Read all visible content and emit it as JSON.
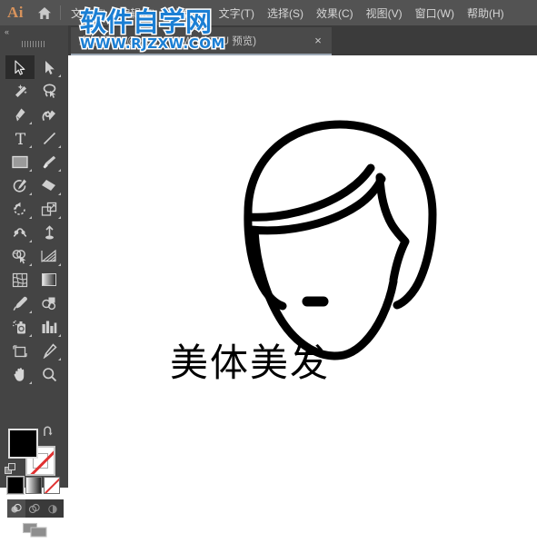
{
  "app": {
    "logo_text": "Ai",
    "home_icon": "home-icon"
  },
  "menu": {
    "items": [
      {
        "label": "文件(F)"
      },
      {
        "label": "编辑(E)"
      },
      {
        "label": "对象(O)"
      },
      {
        "label": "文字(T)"
      },
      {
        "label": "选择(S)"
      },
      {
        "label": "效果(C)"
      },
      {
        "label": "视图(V)"
      },
      {
        "label": "窗口(W)"
      },
      {
        "label": "帮助(H)"
      }
    ]
  },
  "tabs": {
    "active": {
      "title": "未标题-1* @ 100% (CMYK/GPU 预览)",
      "close_label": "×"
    }
  },
  "left_panel": {
    "collapse_label": "«"
  },
  "toolbar": {
    "tools": [
      {
        "name": "selection-tool",
        "active": true,
        "corner": false
      },
      {
        "name": "direct-selection-tool",
        "active": false,
        "corner": true
      },
      {
        "name": "magic-wand-tool",
        "active": false,
        "corner": false
      },
      {
        "name": "lasso-tool",
        "active": false,
        "corner": false
      },
      {
        "name": "pen-tool",
        "active": false,
        "corner": true
      },
      {
        "name": "curvature-tool",
        "active": false,
        "corner": false
      },
      {
        "name": "type-tool",
        "active": false,
        "corner": true
      },
      {
        "name": "line-segment-tool",
        "active": false,
        "corner": true
      },
      {
        "name": "rectangle-tool",
        "active": false,
        "corner": true
      },
      {
        "name": "paintbrush-tool",
        "active": false,
        "corner": true
      },
      {
        "name": "shaper-tool",
        "active": false,
        "corner": true
      },
      {
        "name": "eraser-tool",
        "active": false,
        "corner": true
      },
      {
        "name": "rotate-tool",
        "active": false,
        "corner": true
      },
      {
        "name": "scale-tool",
        "active": false,
        "corner": true
      },
      {
        "name": "width-tool",
        "active": false,
        "corner": true
      },
      {
        "name": "free-transform-tool",
        "active": false,
        "corner": false
      },
      {
        "name": "shape-builder-tool",
        "active": false,
        "corner": true
      },
      {
        "name": "perspective-grid-tool",
        "active": false,
        "corner": true
      },
      {
        "name": "mesh-tool",
        "active": false,
        "corner": false
      },
      {
        "name": "gradient-tool",
        "active": false,
        "corner": false
      },
      {
        "name": "eyedropper-tool",
        "active": false,
        "corner": true
      },
      {
        "name": "blend-tool",
        "active": false,
        "corner": false
      },
      {
        "name": "symbol-sprayer-tool",
        "active": false,
        "corner": true
      },
      {
        "name": "column-graph-tool",
        "active": false,
        "corner": true
      },
      {
        "name": "artboard-tool",
        "active": false,
        "corner": false
      },
      {
        "name": "slice-tool",
        "active": false,
        "corner": true
      },
      {
        "name": "hand-tool",
        "active": false,
        "corner": true
      },
      {
        "name": "zoom-tool",
        "active": false,
        "corner": false
      }
    ],
    "fill_color": "#000000",
    "stroke_color": "#ffffff",
    "swap_label": "⤴",
    "color_modes": [
      {
        "name": "color-mode-solid",
        "selected": true
      },
      {
        "name": "color-mode-gradient",
        "selected": false
      },
      {
        "name": "color-mode-none",
        "selected": false
      }
    ],
    "draw_modes": [
      {
        "name": "draw-normal-mode",
        "selected": true
      },
      {
        "name": "draw-behind-mode",
        "selected": false
      },
      {
        "name": "draw-inside-mode",
        "selected": false
      }
    ],
    "screen_mode": "change-screen-mode"
  },
  "artwork": {
    "label": "美体美发",
    "stroke_color": "#000000",
    "icon_name": "woman-face-hair-logo"
  },
  "watermark": {
    "main": "软件自学网",
    "sub": "WWW.RJZXW.COM",
    "color": "#1b7fd4"
  }
}
